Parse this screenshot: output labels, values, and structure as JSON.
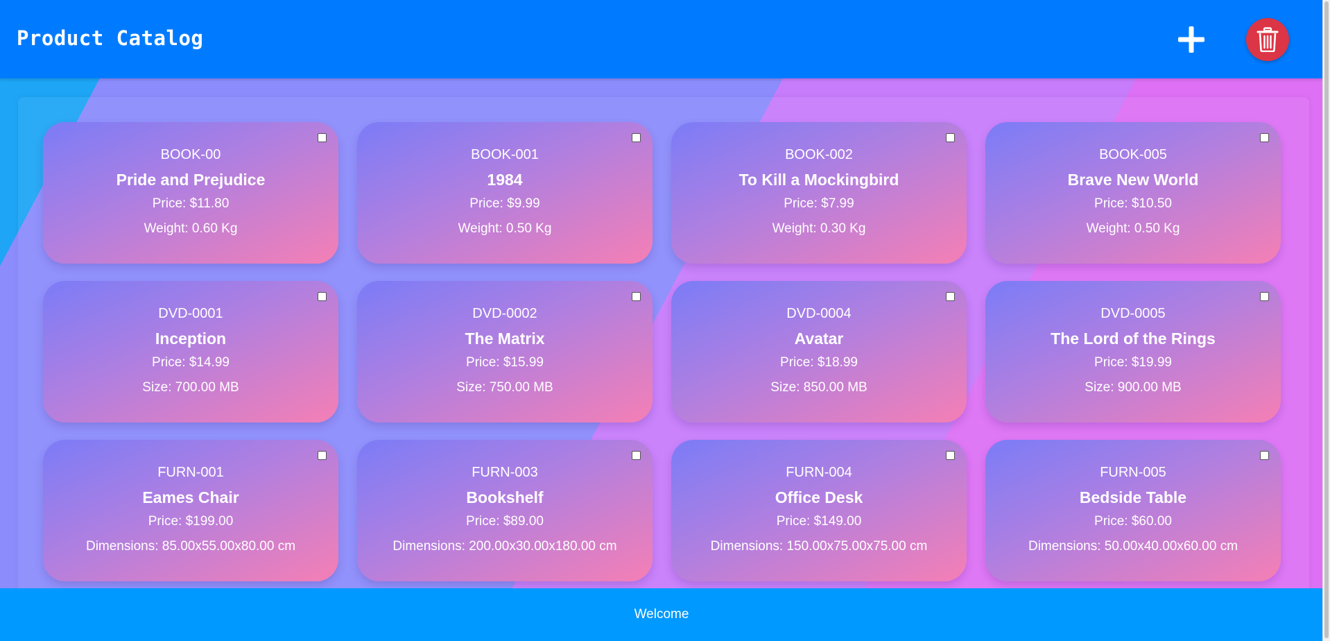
{
  "header": {
    "title": "Product Catalog",
    "add_icon": "plus-icon",
    "delete_icon": "trash-icon",
    "colors": {
      "header_bg": "#007bff",
      "delete_bg": "#dc3545"
    }
  },
  "products": [
    {
      "sku": "BOOK-00",
      "name": "Pride and Prejudice",
      "price": "Price: $11.80",
      "attr": "Weight: 0.60 Kg",
      "checked": false
    },
    {
      "sku": "BOOK-001",
      "name": "1984",
      "price": "Price: $9.99",
      "attr": "Weight: 0.50 Kg",
      "checked": false
    },
    {
      "sku": "BOOK-002",
      "name": "To Kill a Mockingbird",
      "price": "Price: $7.99",
      "attr": "Weight: 0.30 Kg",
      "checked": false
    },
    {
      "sku": "BOOK-005",
      "name": "Brave New World",
      "price": "Price: $10.50",
      "attr": "Weight: 0.50 Kg",
      "checked": false
    },
    {
      "sku": "DVD-0001",
      "name": "Inception",
      "price": "Price: $14.99",
      "attr": "Size: 700.00 MB",
      "checked": false
    },
    {
      "sku": "DVD-0002",
      "name": "The Matrix",
      "price": "Price: $15.99",
      "attr": "Size: 750.00 MB",
      "checked": false
    },
    {
      "sku": "DVD-0004",
      "name": "Avatar",
      "price": "Price: $18.99",
      "attr": "Size: 850.00 MB",
      "checked": false
    },
    {
      "sku": "DVD-0005",
      "name": "The Lord of the Rings",
      "price": "Price: $19.99",
      "attr": "Size: 900.00 MB",
      "checked": false
    },
    {
      "sku": "FURN-001",
      "name": "Eames Chair",
      "price": "Price: $199.00",
      "attr": "Dimensions: 85.00x55.00x80.00 cm",
      "checked": false
    },
    {
      "sku": "FURN-003",
      "name": "Bookshelf",
      "price": "Price: $89.00",
      "attr": "Dimensions: 200.00x30.00x180.00 cm",
      "checked": false
    },
    {
      "sku": "FURN-004",
      "name": "Office Desk",
      "price": "Price: $149.00",
      "attr": "Dimensions: 150.00x75.00x75.00 cm",
      "checked": false
    },
    {
      "sku": "FURN-005",
      "name": "Bedside Table",
      "price": "Price: $60.00",
      "attr": "Dimensions: 50.00x40.00x60.00 cm",
      "checked": false
    }
  ],
  "footer": {
    "text": "Welcome",
    "color": "#0099ff"
  }
}
